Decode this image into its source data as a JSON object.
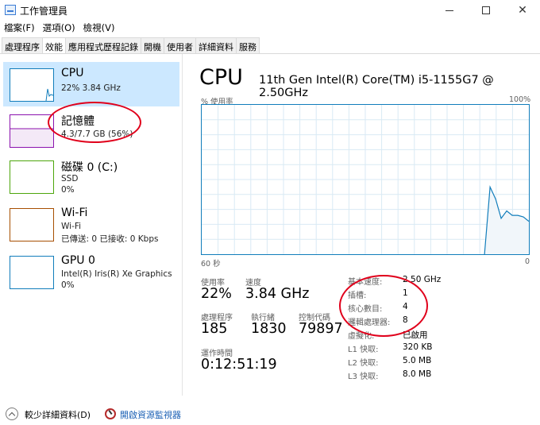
{
  "window": {
    "title": "工作管理員"
  },
  "menu": [
    "檔案(F)",
    "選項(O)",
    "檢視(V)"
  ],
  "tabs": [
    "處理程序",
    "效能",
    "應用程式歷程記錄",
    "開機",
    "使用者",
    "詳細資料",
    "服務"
  ],
  "active_tab": "效能",
  "resources": [
    {
      "name": "CPU",
      "lines": [
        "22% 3.84 GHz"
      ],
      "color": "#117dbb"
    },
    {
      "name": "記憶體",
      "lines": [
        "4.3/7.7 GB (56%)"
      ],
      "color": "#8b12ae"
    },
    {
      "name": "磁碟 0 (C:)",
      "lines": [
        "SSD",
        "0%"
      ],
      "color": "#4da60c"
    },
    {
      "name": "Wi-Fi",
      "lines": [
        "Wi-Fi",
        "已傳送: 0 已接收: 0 Kbps"
      ],
      "color": "#a74f01"
    },
    {
      "name": "GPU 0",
      "lines": [
        "Intel(R) Iris(R) Xe Graphics",
        "0%"
      ],
      "color": "#117dbb"
    }
  ],
  "detail": {
    "title": "CPU",
    "model": "11th Gen Intel(R) Core(TM) i5-1155G7 @ 2.50GHz",
    "graph_label": "% 使用率",
    "graph_max": "100%",
    "graph_time": "60 秒",
    "graph_min": "0",
    "utilization_history": [
      0,
      0,
      0,
      0,
      0,
      0,
      0,
      0,
      0,
      0,
      0,
      0,
      0,
      0,
      0,
      0,
      0,
      0,
      0,
      0,
      0,
      0,
      0,
      0,
      0,
      0,
      0,
      0,
      0,
      0,
      0,
      0,
      0,
      0,
      0,
      0,
      0,
      0,
      0,
      0,
      0,
      0,
      0,
      0,
      0,
      0,
      0,
      0,
      0,
      0,
      0,
      0,
      45,
      37,
      24,
      29,
      26,
      26,
      25,
      22
    ]
  },
  "stats": {
    "util_label": "使用率",
    "util_value": "22%",
    "speed_label": "速度",
    "speed_value": "3.84 GHz",
    "proc_label": "處理程序",
    "proc_value": "185",
    "thread_label": "執行緒",
    "thread_value": "1830",
    "handle_label": "控制代碼",
    "handle_value": "79897",
    "uptime_label": "運作時間",
    "uptime_value": "0:12:51:19"
  },
  "specs": [
    {
      "label": "基本速度:",
      "value": "2.50 GHz"
    },
    {
      "label": "插槽:",
      "value": "1"
    },
    {
      "label": "核心數目:",
      "value": "4"
    },
    {
      "label": "邏輯處理器:",
      "value": "8"
    },
    {
      "label": "虛擬化:",
      "value": "已啟用"
    },
    {
      "label": "L1 快取:",
      "value": "320 KB"
    },
    {
      "label": "L2 快取:",
      "value": "5.0 MB"
    },
    {
      "label": "L3 快取:",
      "value": "8.0 MB"
    }
  ],
  "bottom": {
    "fewer_details": "較少詳細資料(D)",
    "resource_monitor": "開啟資源監視器"
  },
  "annotation_color": "#e0001b"
}
